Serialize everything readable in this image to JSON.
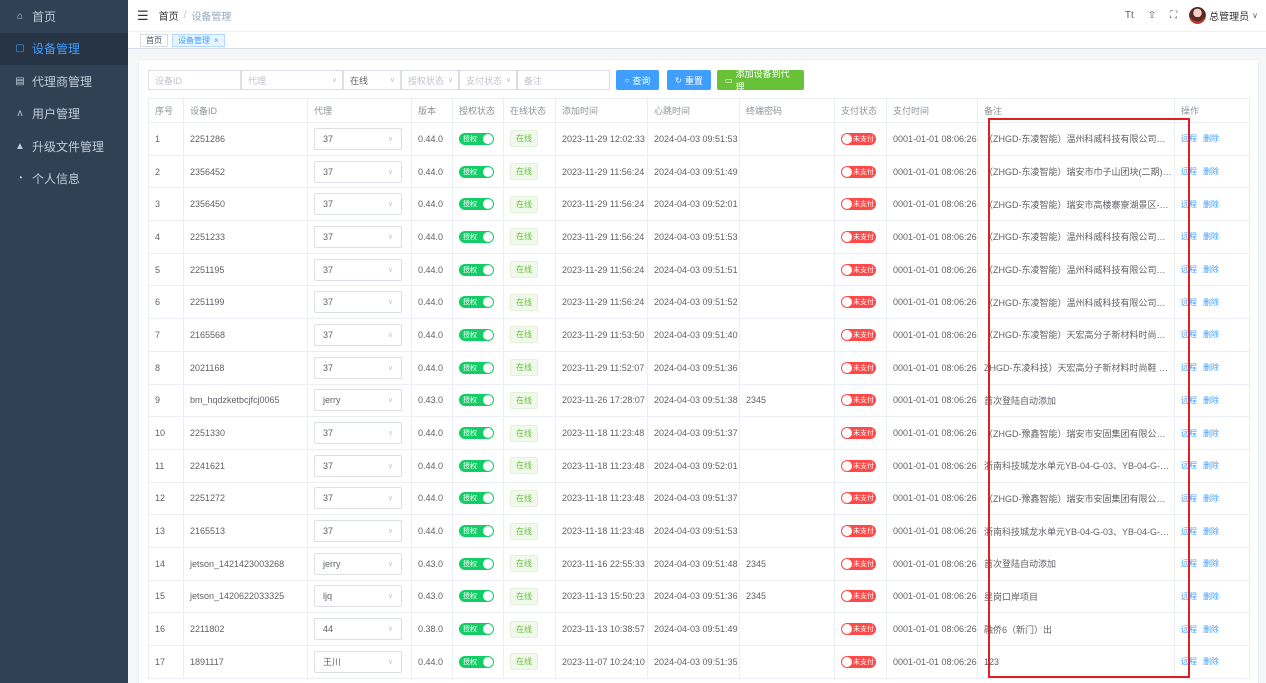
{
  "sidebar": {
    "items": [
      {
        "label": "首页",
        "icon": "home-icon",
        "glyph": "⌂",
        "active": false
      },
      {
        "label": "设备管理",
        "icon": "device-icon",
        "glyph": "▢",
        "active": true
      },
      {
        "label": "代理商管理",
        "icon": "agent-icon",
        "glyph": "▤",
        "active": false
      },
      {
        "label": "用户管理",
        "icon": "user-icon",
        "glyph": "ᴧ",
        "active": false
      },
      {
        "label": "升级文件管理",
        "icon": "upgrade-icon",
        "glyph": "▲",
        "active": false
      },
      {
        "label": "个人信息",
        "icon": "profile-icon",
        "glyph": "◔",
        "active": false
      }
    ]
  },
  "header": {
    "breadcrumb_home": "首页",
    "breadcrumb_sep": "/",
    "breadcrumb_current": "设备管理",
    "icon_font": "Tt",
    "icon_theme": "⇧",
    "icon_fullscreen": "⛶",
    "username": "总管理员",
    "caret": "∨"
  },
  "tags": {
    "home": "首页",
    "device": "设备管理",
    "close": "×"
  },
  "filters": {
    "device_id_placeholder": "设备ID",
    "agent_placeholder": "代理",
    "online_value": "在线",
    "auth_placeholder": "授权状态",
    "pay_placeholder": "支付状态",
    "remark_placeholder": "备注",
    "search_label": "查询",
    "reset_label": "重置",
    "add_label": "添加设备到代理"
  },
  "table": {
    "headers": [
      "序号",
      "设备ID",
      "代理",
      "版本",
      "授权状态",
      "在线状态",
      "添加时间",
      "心跳时间",
      "终端密码",
      "支付状态",
      "支付时间",
      "备注",
      "操作"
    ],
    "auth_on": "授权",
    "online_text": "在线",
    "unpaid_text": "未支付",
    "remote_label": "远程",
    "delete_label": "删除",
    "rows": [
      {
        "no": "1",
        "id": "2251286",
        "agent": "37",
        "ver": "0.44.0",
        "add": "2023-11-29 12:02:33",
        "hb": "2024-04-03 09:51:53",
        "pwd": "",
        "pay_time": "0001-01-01 08:06:26",
        "remark": "（ZHGD-东凌智能）温州科威科技有限公司厂房续建工程"
      },
      {
        "no": "2",
        "id": "2356452",
        "agent": "37",
        "ver": "0.44.0",
        "add": "2023-11-29 11:56:24",
        "hb": "2024-04-03 09:51:49",
        "pwd": "",
        "pay_time": "0001-01-01 08:06:26",
        "remark": "（ZHGD-东凌智能）瑞安市巾子山团块(二期)城市更新项目"
      },
      {
        "no": "3",
        "id": "2356450",
        "agent": "37",
        "ver": "0.44.0",
        "add": "2023-11-29 11:56:24",
        "hb": "2024-04-03 09:52:01",
        "pwd": "",
        "pay_time": "0001-01-01 08:06:26",
        "remark": "（ZHGD-东凌智能）瑞安市高楼寨寮湖景区-露营基地项目"
      },
      {
        "no": "4",
        "id": "2251233",
        "agent": "37",
        "ver": "0.44.0",
        "add": "2023-11-29 11:56:24",
        "hb": "2024-04-03 09:51:53",
        "pwd": "",
        "pay_time": "0001-01-01 08:06:26",
        "remark": "（ZHGD-东凌智能）温州科威科技有限公司厂房续建工程"
      },
      {
        "no": "5",
        "id": "2251195",
        "agent": "37",
        "ver": "0.44.0",
        "add": "2023-11-29 11:56:24",
        "hb": "2024-04-03 09:51:51",
        "pwd": "",
        "pay_time": "0001-01-01 08:06:26",
        "remark": "（ZHGD-东凌智能）温州科威科技有限公司厂房续建工程"
      },
      {
        "no": "6",
        "id": "2251199",
        "agent": "37",
        "ver": "0.44.0",
        "add": "2023-11-29 11:56:24",
        "hb": "2024-04-03 09:51:52",
        "pwd": "",
        "pay_time": "0001-01-01 08:06:26",
        "remark": "（ZHGD-东凌智能）温州科威科技有限公司厂房续建工程"
      },
      {
        "no": "7",
        "id": "2165568",
        "agent": "37",
        "ver": "0.44.0",
        "add": "2023-11-29 11:53:50",
        "hb": "2024-04-03 09:51:40",
        "pwd": "",
        "pay_time": "0001-01-01 08:06:26",
        "remark": "（ZHGD-东凌智能）天宏高分子新材料时尚鞋 智造项目"
      },
      {
        "no": "8",
        "id": "2021168",
        "agent": "37",
        "ver": "0.44.0",
        "add": "2023-11-29 11:52:07",
        "hb": "2024-04-03 09:51:36",
        "pwd": "",
        "pay_time": "0001-01-01 08:06:26",
        "remark": "ZHGD-东凌科技）天宏高分子新材料时尚鞋 智造项目"
      },
      {
        "no": "9",
        "id": "bm_hqdzketbcjfcj0065",
        "agent": "jerry",
        "ver": "0.43.0",
        "add": "2023-11-26 17:28:07",
        "hb": "2024-04-03 09:51:38",
        "pwd": "2345",
        "pay_time": "0001-01-01 08:06:26",
        "remark": "首次登陆自动添加"
      },
      {
        "no": "10",
        "id": "2251330",
        "agent": "37",
        "ver": "0.44.0",
        "add": "2023-11-18 11:23:48",
        "hb": "2024-04-03 09:51:37",
        "pwd": "",
        "pay_time": "0001-01-01 08:06:26",
        "remark": "（ZHGD-豫鑫智能）瑞安市安固集团有限公司年产项目"
      },
      {
        "no": "11",
        "id": "2241621",
        "agent": "37",
        "ver": "0.44.0",
        "add": "2023-11-18 11:23:48",
        "hb": "2024-04-03 09:52:01",
        "pwd": "",
        "pay_time": "0001-01-01 08:06:26",
        "remark": "浙南科技城龙水单元YB-04-G-03、YB-04-G-16地块项目"
      },
      {
        "no": "12",
        "id": "2251272",
        "agent": "37",
        "ver": "0.44.0",
        "add": "2023-11-18 11:23:48",
        "hb": "2024-04-03 09:51:37",
        "pwd": "",
        "pay_time": "0001-01-01 08:06:26",
        "remark": "（ZHGD-豫鑫智能）瑞安市安固集团有限公司年产项目"
      },
      {
        "no": "13",
        "id": "2165513",
        "agent": "37",
        "ver": "0.44.0",
        "add": "2023-11-18 11:23:48",
        "hb": "2024-04-03 09:51:53",
        "pwd": "",
        "pay_time": "0001-01-01 08:06:26",
        "remark": "浙南科技城龙水单元YB-04-G-03、YB-04-G-16地块项目"
      },
      {
        "no": "14",
        "id": "jetson_1421423003268",
        "agent": "jerry",
        "ver": "0.43.0",
        "add": "2023-11-16 22:55:33",
        "hb": "2024-04-03 09:51:48",
        "pwd": "2345",
        "pay_time": "0001-01-01 08:06:26",
        "remark": "首次登陆自动添加"
      },
      {
        "no": "15",
        "id": "jetson_1420622033325",
        "agent": "ljq",
        "ver": "0.43.0",
        "add": "2023-11-13 15:50:23",
        "hb": "2024-04-03 09:51:36",
        "pwd": "2345",
        "pay_time": "0001-01-01 08:06:26",
        "remark": "星岗口岸项目"
      },
      {
        "no": "16",
        "id": "2211802",
        "agent": "44",
        "ver": "0.38.0",
        "add": "2023-11-13 10:38:57",
        "hb": "2024-04-03 09:51:49",
        "pwd": "",
        "pay_time": "0001-01-01 08:06:26",
        "remark": "融侨6（新门）出"
      },
      {
        "no": "17",
        "id": "1891117",
        "agent": "王川",
        "ver": "0.44.0",
        "add": "2023-11-07 10:24:10",
        "hb": "2024-04-03 09:51:35",
        "pwd": "",
        "pay_time": "0001-01-01 08:06:26",
        "remark": "123"
      }
    ]
  },
  "colors": {
    "sidebar_bg": "#304156",
    "accent": "#409eff",
    "success": "#67c23a",
    "switch_on": "#13ce66",
    "switch_off": "#ff4949",
    "highlight_box": "#e02020"
  }
}
